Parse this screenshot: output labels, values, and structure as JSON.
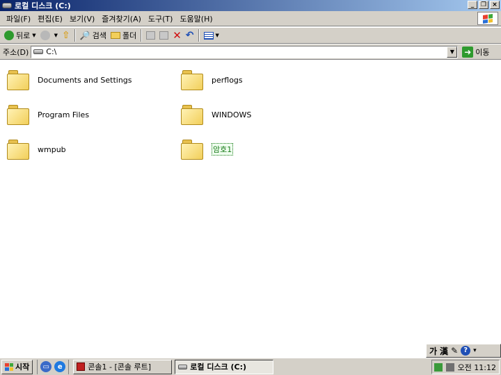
{
  "window": {
    "title": "로컬 디스크 (C:)",
    "buttons": {
      "minimize": "_",
      "restore": "❐",
      "close": "×"
    }
  },
  "menu": [
    "파일(F)",
    "편집(E)",
    "보기(V)",
    "즐겨찾기(A)",
    "도구(T)",
    "도움말(H)"
  ],
  "toolbar": {
    "back": "뒤로",
    "search": "검색",
    "folders": "폴더"
  },
  "address": {
    "label": "주소(D)",
    "value": "C:\\",
    "go": "이동"
  },
  "items": [
    {
      "name": "Documents and Settings"
    },
    {
      "name": "perflogs"
    },
    {
      "name": "Program Files"
    },
    {
      "name": "WINDOWS"
    },
    {
      "name": "wmpub"
    },
    {
      "name": "암호1"
    }
  ],
  "langbar": {
    "hangul": "가",
    "hanja": "漢"
  },
  "taskbar": {
    "start": "시작",
    "tasks": [
      "콘솔1 - [콘솔 루트]",
      "로컬 디스크 (C:)"
    ],
    "clock": "오전 11:12"
  },
  "colors": {
    "title_start": "#0a246a",
    "title_end": "#a6caf0",
    "face": "#d4d0c8",
    "folder": "#f2cf5a",
    "selected": "#1a7a1a"
  }
}
